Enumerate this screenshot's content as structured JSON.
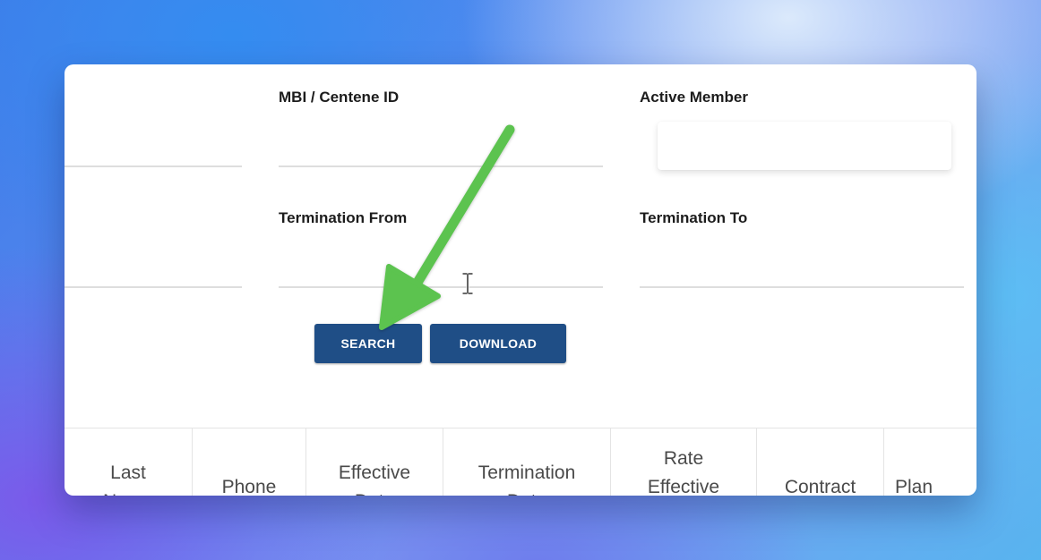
{
  "filters": {
    "mbi_label": "MBI / Centene ID",
    "active_member_label": "Active Member",
    "termination_from_label": "Termination From",
    "termination_to_label": "Termination To"
  },
  "buttons": {
    "search": "SEARCH",
    "download": "DOWNLOAD"
  },
  "table": {
    "columns": [
      {
        "line1": "Last",
        "line2": "Name"
      },
      {
        "line1": "",
        "line2": "Phone"
      },
      {
        "line1": "Effective",
        "line2": "Date"
      },
      {
        "line1": "Termination",
        "line2": "Date"
      },
      {
        "line1": "Rate",
        "line2": "Effective"
      },
      {
        "line1": "",
        "line2": "Contract"
      },
      {
        "line1": "",
        "line2": "Plan"
      }
    ]
  },
  "annotation": {
    "arrow_color": "#5bc34f",
    "button_color": "#1f4e86"
  },
  "icons": {
    "cursor": "text-cursor-icon",
    "arrow": "annotation-arrow-icon"
  }
}
